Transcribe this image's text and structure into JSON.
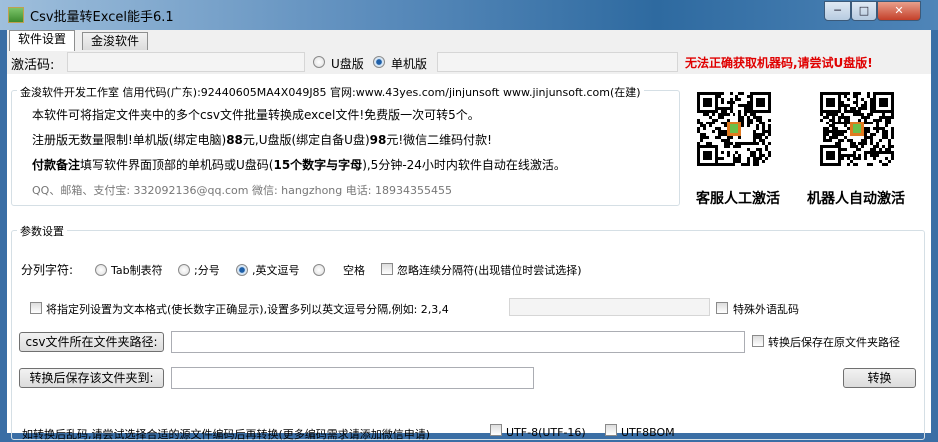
{
  "window": {
    "title": "Csv批量转Excel能手6.1",
    "min": "─",
    "max": "□",
    "close": "✕"
  },
  "tabs": [
    {
      "label": "软件设置"
    },
    {
      "label": "金浚软件"
    }
  ],
  "activation": {
    "label": "激活码:",
    "value": "",
    "radio_usb": "U盘版",
    "radio_pc": "单机版",
    "selected": "单机版",
    "machine_code": "",
    "warning": "无法正确获取机器码,请尝试U盘版!",
    "warning_color": "#e00000"
  },
  "info": {
    "legend": "金浚软件开发工作室 信用代码(广东):92440605MA4X049J85 官网:www.43yes.com/jinjunsoft  www.jinjunsoft.com(在建)",
    "line1": "本软件可将指定文件夹中的多个csv文件批量转换成excel文件!免费版一次可转5个。",
    "line2_a": "注册版无数量限制!单机版(绑定电脑)",
    "line2_b": "88",
    "line2_c": "元,U盘版(绑定自备U盘)",
    "line2_d": "98",
    "line2_e": "元!微信二维码付款!",
    "line3_a": "付款备注",
    "line3_b": "填写软件界面顶部的单机码或U盘码(",
    "line3_c": "15个数字与字母",
    "line3_d": "),5分钟-24小时内软件自动在线激活。",
    "contact": "QQ、邮箱、支付宝: 332092136@qq.com   微信: hangzhong   电话: 18934355455"
  },
  "qr": {
    "left_caption": "客服人工激活",
    "right_caption": "机器人自动激活"
  },
  "params": {
    "legend": "参数设置",
    "delimiter_label": "分列字符:",
    "delims": [
      "Tab制表符",
      ";分号",
      ",英文逗号",
      "空格"
    ],
    "delim_selected": ",英文逗号",
    "ignore_consecutive": "忽略连续分隔符(出现错位时尝试选择)",
    "text_cols_label": "将指定列设置为文本格式(使长数字正确显示),设置多列以英文逗号分隔,例如: 2,3,4",
    "text_cols_value": "",
    "special_lang": "特殊外语乱码",
    "src_button": "csv文件所在文件夹路径:",
    "src_value": "",
    "save_in_place": "转换后保存在原文件夹路径",
    "dst_button": "转换后保存该文件夹到:",
    "dst_value": "",
    "convert_button": "转换",
    "encoding_hint": "如转换后乱码,请尝试选择合适的源文件编码后再转换(更多编码需求请添加微信申请)",
    "enc1": "UTF-8(UTF-16)",
    "enc2": "UTF8BOM"
  }
}
